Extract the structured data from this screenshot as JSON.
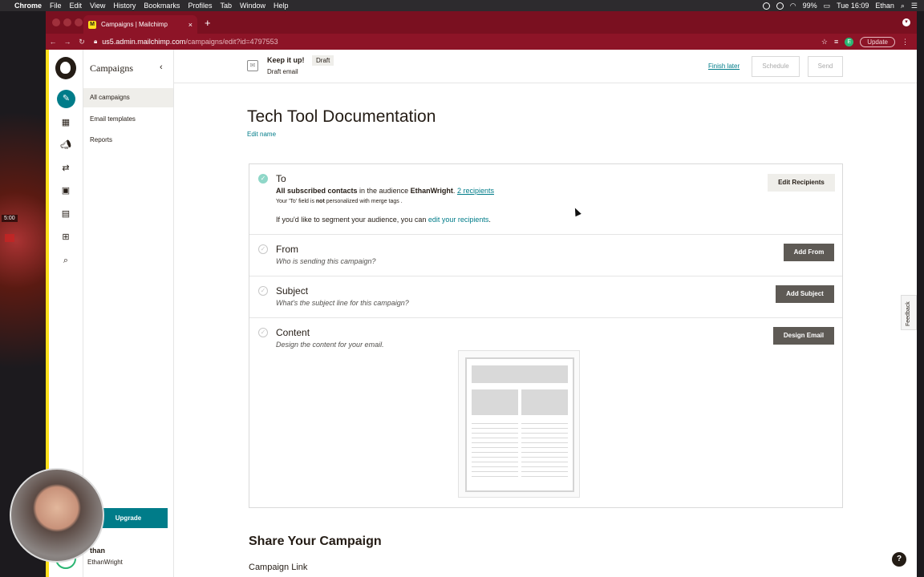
{
  "os_menubar": {
    "app": "Chrome",
    "menus": [
      "File",
      "Edit",
      "View",
      "History",
      "Bookmarks",
      "Profiles",
      "Tab",
      "Window",
      "Help"
    ],
    "battery": "99%",
    "clock": "Tue 16:09",
    "user": "Ethan"
  },
  "desktop": {
    "clock_overlay": "5:00"
  },
  "browser": {
    "tab_title": "Campaigns | Mailchimp",
    "url_host": "us5.admin.mailchimp.com",
    "url_path": "/campaigns/edit?id=4797553",
    "profile_initial": "E",
    "update_label": "Update"
  },
  "sidebar": {
    "title": "Campaigns",
    "items": [
      {
        "label": "All campaigns",
        "active": true
      },
      {
        "label": "Email templates",
        "active": false
      },
      {
        "label": "Reports",
        "active": false
      }
    ],
    "upgrade_label": "Upgrade",
    "account_name": "than",
    "account_org": "EthanWright"
  },
  "header": {
    "message": "Keep it up!",
    "status_badge": "Draft",
    "subtitle": "Draft email",
    "finish_later": "Finish later",
    "schedule": "Schedule",
    "send": "Send"
  },
  "campaign": {
    "name": "Tech Tool Documentation",
    "edit_name": "Edit name"
  },
  "checklist": {
    "to": {
      "label": "To",
      "contacts": "All subscribed contacts",
      "audience_prefix": " in the audience ",
      "audience": "EthanWright",
      "recipients_link": "2 recipients",
      "note_prefix": "Your 'To' field is ",
      "note_bold": "not",
      "note_suffix": " personalized with merge tags .",
      "segment_prefix": "If you'd like to segment your audience, you can ",
      "segment_link": "edit your recipients",
      "button": "Edit Recipients"
    },
    "from": {
      "label": "From",
      "hint": "Who is sending this campaign?",
      "button": "Add From"
    },
    "subject": {
      "label": "Subject",
      "hint": "What's the subject line for this campaign?",
      "button": "Add Subject"
    },
    "content": {
      "label": "Content",
      "hint": "Design the content for your email.",
      "button": "Design Email"
    }
  },
  "share": {
    "title": "Share Your Campaign",
    "link_label": "Campaign Link"
  },
  "feedback_label": "Feedback",
  "help_label": "?"
}
